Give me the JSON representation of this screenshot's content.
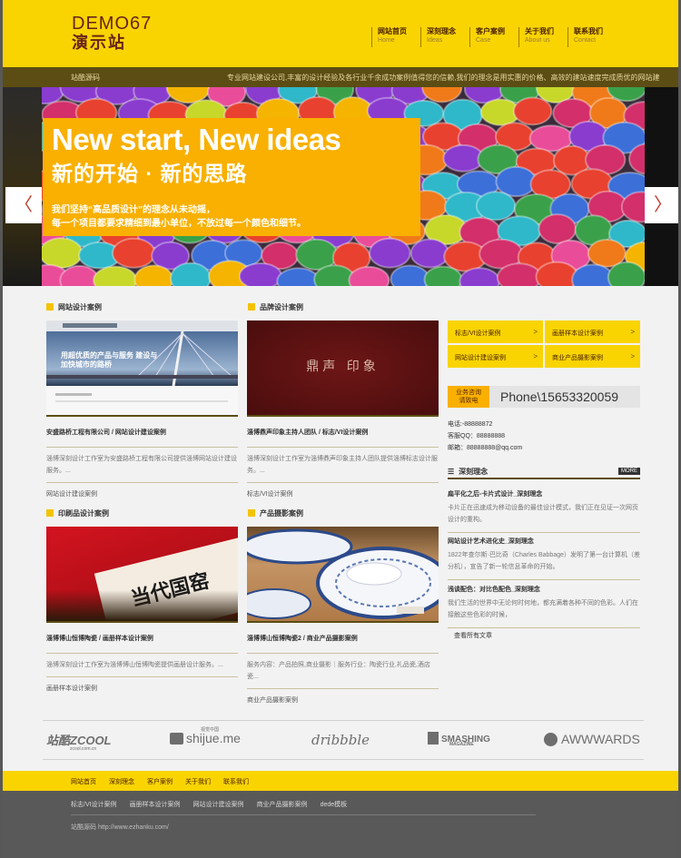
{
  "header": {
    "logo_line1": "DEMO67",
    "logo_line2": "演示站",
    "nav": [
      {
        "cn": "网站首页",
        "en": "Home"
      },
      {
        "cn": "深刻理念",
        "en": "Ideas"
      },
      {
        "cn": "客户案例",
        "en": "Case"
      },
      {
        "cn": "关于我们",
        "en": "About us"
      },
      {
        "cn": "联系我们",
        "en": "Contact"
      }
    ]
  },
  "strip": {
    "left": "站酷源码",
    "right": "专业网站建设公司,丰富的设计经验及各行业千余成功案例值得您的信赖,我们的理念是用实惠的价格、高效的建站速度完成质优的网站建"
  },
  "banner": {
    "title_en": "New start, New ideas",
    "title_cn": "新的开始 · 新的思路",
    "desc1": "我们坚持“高品质设计”的理念从未动摇，",
    "desc2": "每一个项目都要求精细到最小单位，不放过每一个颜色和细节。",
    "prev": "〈",
    "next": "〉"
  },
  "sections": {
    "web": "网站设计案例",
    "brand": "品牌设计案例",
    "print": "印刷品设计案例",
    "photo": "产品摄影案例"
  },
  "cases": [
    {
      "title": "安盛路桥工程有限公司 / 网站设计建设案例",
      "desc": "淄博深刻设计工作室为安盛路桥工程有限公司提供淄博网站设计建设服务。...",
      "cat": "网站设计建设案例",
      "thumb_text": "用超优质的产品与服务 建设与加快城市的路桥"
    },
    {
      "title": "淄博鼎声印象主持人团队 / 标志/VI设计案例",
      "desc": "淄博深刻设计工作室为淄博鼎声印象主持人团队提供淄博标志设计服务。...",
      "cat": "标志/VI设计案例",
      "thumb_text": "鼎声 印象"
    },
    {
      "title": "淄博博山恒博陶瓷 / 画册样本设计案例",
      "desc": "淄博深刻设计工作室为淄博博山恒博陶瓷提供画册设计服务。...",
      "cat": "画册样本设计案例",
      "thumb_text": "当代国窑"
    },
    {
      "title": "淄博博山恒博陶瓷2 / 商业产品摄影案例",
      "desc": "服务内容：产品拍照,商业摄影｜服务行业：陶瓷行业,礼品瓷,酒店瓷...",
      "cat": "商业产品摄影案例",
      "thumb_text": ""
    }
  ],
  "right_grid": [
    "标志/VI设计案例",
    "画册样本设计案例",
    "网站设计建设案例",
    "商业产品摄影案例"
  ],
  "phone": {
    "badge_l1": "业务咨询",
    "badge_l2": "请致电",
    "number": "Phone\\15653320059"
  },
  "contact": {
    "tel": "电话:-88888872",
    "qq": "客服QQ：88888888",
    "email": "邮箱：88888888@qq.com"
  },
  "news_head": {
    "title": "深刻理念",
    "more": "MORE"
  },
  "news": [
    {
      "title": "扁平化之后-卡片式设计_深刻理念",
      "desc": "卡片正在迅速成为移动设备的最佳设计模式，我们正在见证一次网页设计的重构。"
    },
    {
      "title": "网站设计艺术进化史_深刻理念",
      "desc": "1822年查尔斯·巴比奇（Charles Babbage）发明了第一台计算机（差分机），宣告了新一轮信息革命的开始。"
    },
    {
      "title": "浅谈配色：对比色配色_深刻理念",
      "desc": "我们生活的世界中无论何时何地，都充满着各种不同的色彩。人们在接触这些色彩的时候，"
    }
  ],
  "all_news": "查看所有文章",
  "partners": [
    "站酷ZCOOL",
    "shijue.me",
    "dribbble",
    "SMASHING",
    "AWWWARDS"
  ],
  "partner_subs": {
    "zcool": "zcool.com.cn",
    "shijue": "视觉中国",
    "smashing": "MAGAZINE"
  },
  "footer": {
    "nav": [
      "网站首页",
      "深刻理念",
      "客户案例",
      "关于我们",
      "联系我们"
    ],
    "links": [
      "标志/VI设计案例",
      "画册样本设计案例",
      "网站设计建设案例",
      "商业产品摄影案例",
      "dede模板"
    ],
    "copy": "站酷源码 http://www.ezhanku.com/"
  },
  "colors": {
    "accent": "#f9d400",
    "dark": "#5c4d14",
    "orange": "#f9b000"
  }
}
